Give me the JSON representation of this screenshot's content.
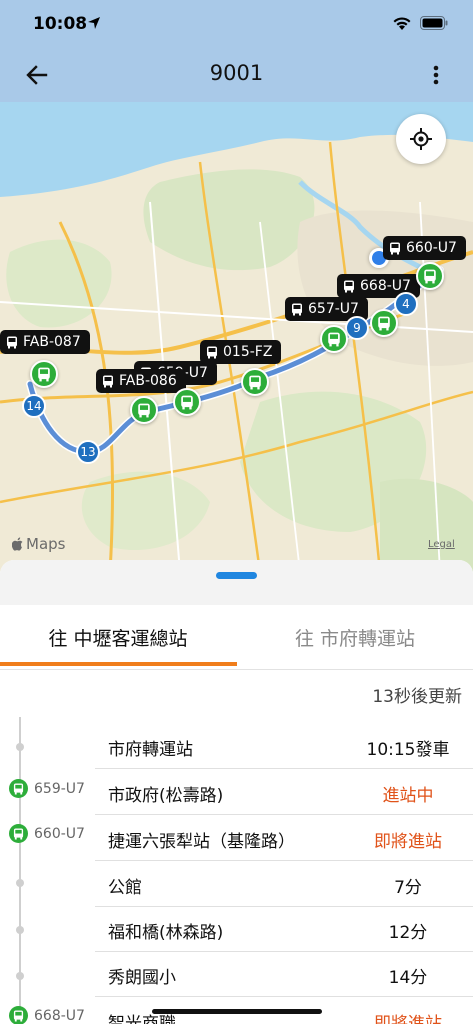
{
  "status_bar": {
    "time": "10:08"
  },
  "header": {
    "title": "9001"
  },
  "map": {
    "attribution": "Maps",
    "legal": "Legal",
    "bus_tags": [
      "660-U7",
      "668-U7",
      "657-U7",
      "015-FZ",
      "FAB-087",
      "FAB-086",
      "659-U7"
    ],
    "stop_numbers": [
      "14",
      "13",
      "9",
      "4"
    ]
  },
  "tabs": [
    {
      "label": "往 中壢客運總站",
      "active": true
    },
    {
      "label": "往 市府轉運站",
      "active": false
    }
  ],
  "update_text": "13秒後更新",
  "buses_on_route": [
    "659-U7",
    "660-U7",
    "668-U7"
  ],
  "stops": [
    {
      "name": "市府轉運站",
      "eta": "10:15發車",
      "status": "normal"
    },
    {
      "name": "市政府(松壽路)",
      "eta": "進站中",
      "status": "alert"
    },
    {
      "name": "捷運六張犁站（基隆路）",
      "eta": "即將進站",
      "status": "alert"
    },
    {
      "name": "公館",
      "eta": "7分",
      "status": "normal"
    },
    {
      "name": "福和橋(林森路)",
      "eta": "12分",
      "status": "normal"
    },
    {
      "name": "秀朗國小",
      "eta": "14分",
      "status": "normal"
    },
    {
      "name": "智光商職",
      "eta": "即將進站",
      "status": "alert"
    }
  ],
  "colors": {
    "header_bg": "#a9c9e8",
    "accent": "#f07d1b",
    "bus_green": "#2dad3a",
    "alert": "#e0531a",
    "stop_blue": "#1f6fbf"
  }
}
